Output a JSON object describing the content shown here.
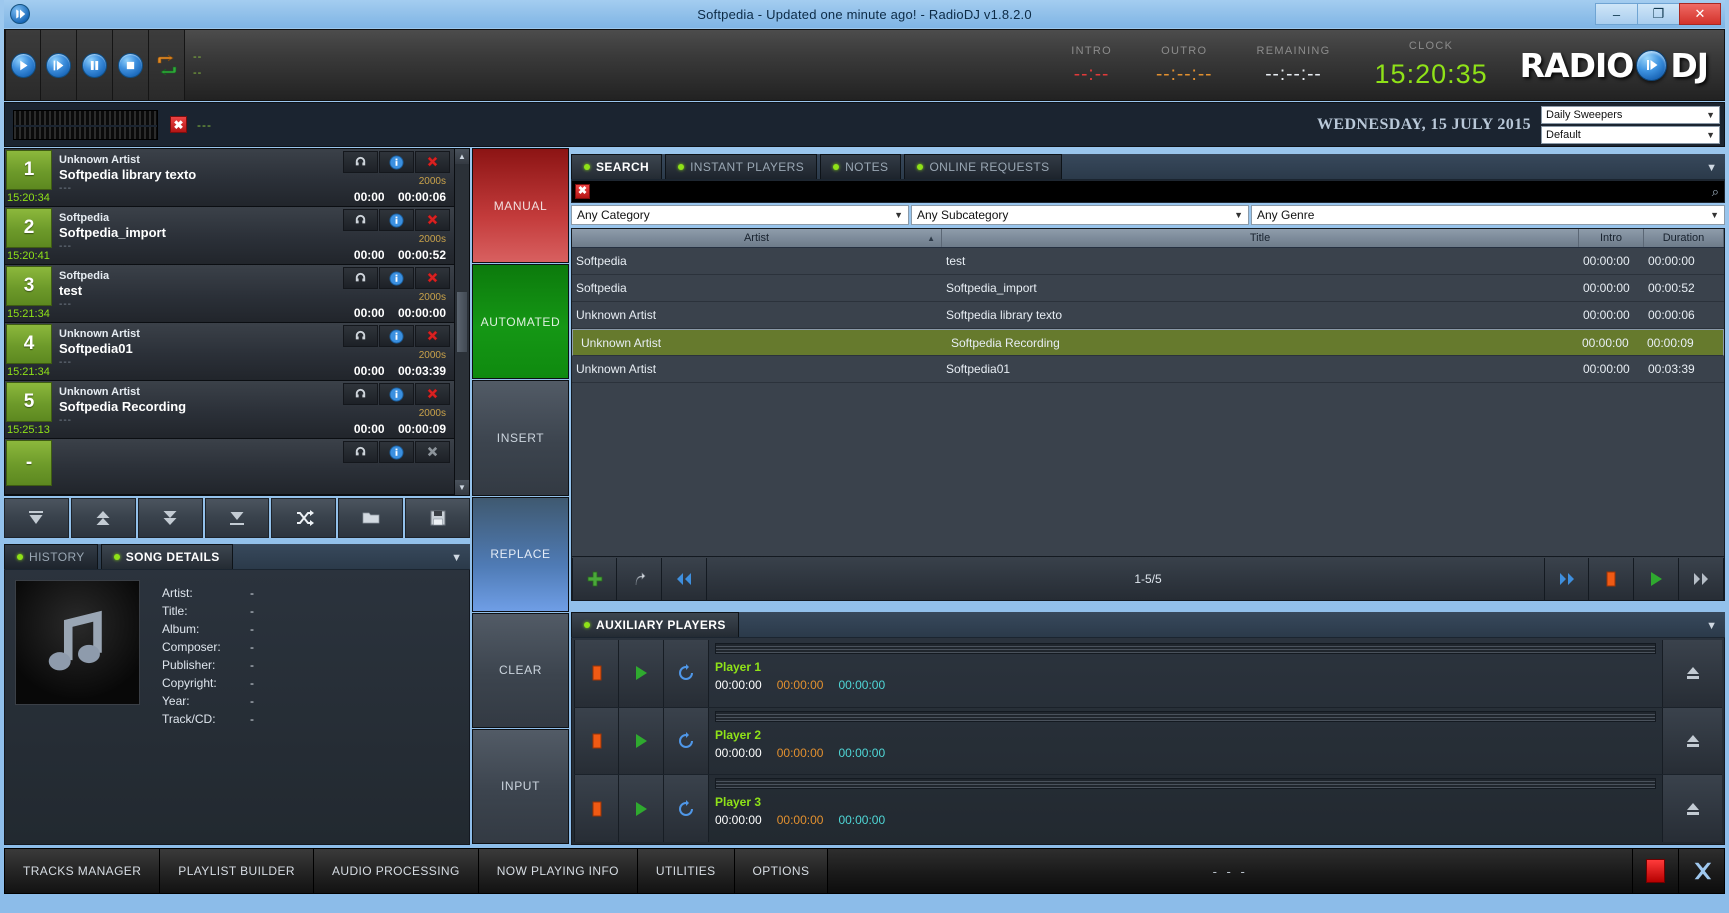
{
  "window": {
    "title": "Softpedia - Updated one minute ago! - RadioDJ v1.8.2.0",
    "minimize": "–",
    "maximize": "❐",
    "close": "✕",
    "app_icon": "play-circle-icon"
  },
  "header": {
    "transport": [
      {
        "name": "play-button",
        "icon": "play-icon"
      },
      {
        "name": "play-next-button",
        "icon": "play-next-icon"
      },
      {
        "name": "pause-button",
        "icon": "pause-icon"
      },
      {
        "name": "stop-button",
        "icon": "stop-icon"
      },
      {
        "name": "rotation-button",
        "icon": "recycle-icon"
      }
    ],
    "status_dash_top": "--",
    "status_dash_bottom": "--",
    "timers": [
      {
        "label": "INTRO",
        "value": "--:--",
        "color": "#e03a3a"
      },
      {
        "label": "OUTRO",
        "value": "--:--:--",
        "color": "#e2902f"
      },
      {
        "label": "REMAINING",
        "value": "--:--:--",
        "color": "#e9eef3"
      },
      {
        "label": "CLOCK",
        "value": "15:20:35",
        "color": "#8fe218"
      }
    ],
    "logo_left": "RADIO",
    "logo_right": "DJ"
  },
  "subbar": {
    "vu_meter": "vu-meter",
    "clear_icon": "✖",
    "dash": "---",
    "date": "WEDNESDAY, 15 JULY 2015",
    "select_top": "Daily Sweepers",
    "select_bottom": "Default"
  },
  "playlist": {
    "rows": [
      {
        "num": "1",
        "time": "15:20:34",
        "artist": "Unknown Artist",
        "title": "Softpedia library texto",
        "sub": "---",
        "sub2": "---",
        "tag": "2000s",
        "intro": "00:00",
        "duration": "00:00:06"
      },
      {
        "num": "2",
        "time": "15:20:41",
        "artist": "Softpedia",
        "title": "Softpedia_import",
        "sub": "---",
        "sub2": "---",
        "tag": "2000s",
        "intro": "00:00",
        "duration": "00:00:52"
      },
      {
        "num": "3",
        "time": "15:21:34",
        "artist": "Softpedia",
        "title": "test",
        "sub": "---",
        "sub2": "---",
        "tag": "2000s",
        "intro": "00:00",
        "duration": "00:00:00"
      },
      {
        "num": "4",
        "time": "15:21:34",
        "artist": "Unknown Artist",
        "title": "Softpedia01",
        "sub": "---",
        "sub2": "---",
        "tag": "2000s",
        "intro": "00:00",
        "duration": "00:03:39"
      },
      {
        "num": "5",
        "time": "15:25:13",
        "artist": "Unknown Artist",
        "title": "Softpedia Recording",
        "sub": "---",
        "sub2": "---",
        "tag": "2000s",
        "intro": "00:00",
        "duration": "00:00:09"
      }
    ],
    "empty_row": {
      "num": "-"
    },
    "footer_left": "--:--:--",
    "footer_intro": "--:--",
    "footer_duration": "--:--:--",
    "row_icons": [
      {
        "name": "cue-headphone-icon"
      },
      {
        "name": "info-icon"
      },
      {
        "name": "remove-icon"
      }
    ],
    "tools": [
      {
        "name": "move-to-top-button",
        "icon": "move-to-top-icon"
      },
      {
        "name": "move-up-button",
        "icon": "move-up-icon"
      },
      {
        "name": "move-down-button",
        "icon": "move-down-icon"
      },
      {
        "name": "move-to-bottom-button",
        "icon": "move-to-bottom-icon"
      },
      {
        "name": "shuffle-button",
        "icon": "shuffle-icon"
      },
      {
        "name": "open-playlist-button",
        "icon": "folder-icon"
      },
      {
        "name": "save-playlist-button",
        "icon": "floppy-disk-icon"
      }
    ]
  },
  "left_tabs": [
    {
      "label": "HISTORY",
      "active": false
    },
    {
      "label": "SONG DETAILS",
      "active": true
    }
  ],
  "song_details": {
    "album_art": "music-note-icon",
    "fields": [
      {
        "key": "Artist:",
        "value": "-"
      },
      {
        "key": "Title:",
        "value": "-"
      },
      {
        "key": "Album:",
        "value": "-"
      },
      {
        "key": "Composer:",
        "value": "-"
      },
      {
        "key": "Publisher:",
        "value": "-"
      },
      {
        "key": "Copyright:",
        "value": "-"
      },
      {
        "key": "Year:",
        "value": "-"
      },
      {
        "key": "Track/CD:",
        "value": "-"
      }
    ]
  },
  "modes": [
    {
      "label": "MANUAL",
      "style": "manual"
    },
    {
      "label": "AUTOMATED",
      "style": "auto"
    },
    {
      "label": "INSERT",
      "style": "plain"
    },
    {
      "label": "REPLACE",
      "style": "replace"
    },
    {
      "label": "CLEAR",
      "style": "plain"
    },
    {
      "label": "INPUT",
      "style": "plain"
    }
  ],
  "search": {
    "tabs": [
      {
        "label": "SEARCH",
        "active": true
      },
      {
        "label": "INSTANT PLAYERS",
        "active": false
      },
      {
        "label": "NOTES",
        "active": false
      },
      {
        "label": "ONLINE REQUESTS",
        "active": false
      }
    ],
    "query": "",
    "placeholder": "",
    "clear_icon": "✖",
    "magnifier_icon": "⌕",
    "filters": [
      {
        "label": "Any Category"
      },
      {
        "label": "Any Subcategory"
      },
      {
        "label": "Any Genre"
      }
    ],
    "columns": [
      {
        "label": "Artist",
        "sorted": true
      },
      {
        "label": "Title",
        "sorted": false
      },
      {
        "label": "Intro",
        "sorted": false
      },
      {
        "label": "Duration",
        "sorted": false
      }
    ],
    "rows": [
      {
        "artist": "Softpedia",
        "title": "test",
        "intro": "00:00:00",
        "duration": "00:00:00",
        "selected": false
      },
      {
        "artist": "Softpedia",
        "title": "Softpedia_import",
        "intro": "00:00:00",
        "duration": "00:00:52",
        "selected": false
      },
      {
        "artist": "Unknown Artist",
        "title": "Softpedia library texto",
        "intro": "00:00:00",
        "duration": "00:00:06",
        "selected": false
      },
      {
        "artist": "Unknown Artist",
        "title": "Softpedia Recording",
        "intro": "00:00:00",
        "duration": "00:00:09",
        "selected": true
      },
      {
        "artist": "Unknown Artist",
        "title": "Softpedia01",
        "intro": "00:00:00",
        "duration": "00:03:39",
        "selected": false
      }
    ],
    "page_info": "1-5/5",
    "left_buttons": [
      {
        "name": "add-track-button",
        "icon": "plus-icon"
      },
      {
        "name": "add-next-button",
        "icon": "curved-arrow-icon"
      },
      {
        "name": "previous-page-button",
        "icon": "double-left-icon"
      }
    ],
    "right_buttons": [
      {
        "name": "next-page-button",
        "icon": "double-right-blue-icon"
      },
      {
        "name": "stop-preview-button",
        "icon": "stop-orange-icon"
      },
      {
        "name": "play-preview-button",
        "icon": "play-green-icon"
      },
      {
        "name": "last-page-button",
        "icon": "double-right-gray-icon"
      }
    ]
  },
  "aux": {
    "tab_label": "AUXILIARY PLAYERS",
    "players": [
      {
        "name": "Player 1",
        "elapsed": "00:00:00",
        "remaining": "00:00:00",
        "total": "00:00:00"
      },
      {
        "name": "Player 2",
        "elapsed": "00:00:00",
        "remaining": "00:00:00",
        "total": "00:00:00"
      },
      {
        "name": "Player 3",
        "elapsed": "00:00:00",
        "remaining": "00:00:00",
        "total": "00:00:00"
      }
    ],
    "buttons": [
      {
        "name": "player-stop-button",
        "icon": "stop-orange-icon"
      },
      {
        "name": "player-play-button",
        "icon": "play-green-icon"
      },
      {
        "name": "player-loop-button",
        "icon": "loop-icon"
      }
    ],
    "eject": "eject-icon"
  },
  "bottom": {
    "buttons": [
      {
        "label": "TRACKS MANAGER"
      },
      {
        "label": "PLAYLIST BUILDER"
      },
      {
        "label": "AUDIO PROCESSING"
      },
      {
        "label": "NOW PLAYING INFO"
      },
      {
        "label": "UTILITIES"
      },
      {
        "label": "OPTIONS"
      }
    ],
    "status": "- - -",
    "stop_icon": "stop-red-icon",
    "fullscreen_icon": "fullscreen-icon"
  }
}
